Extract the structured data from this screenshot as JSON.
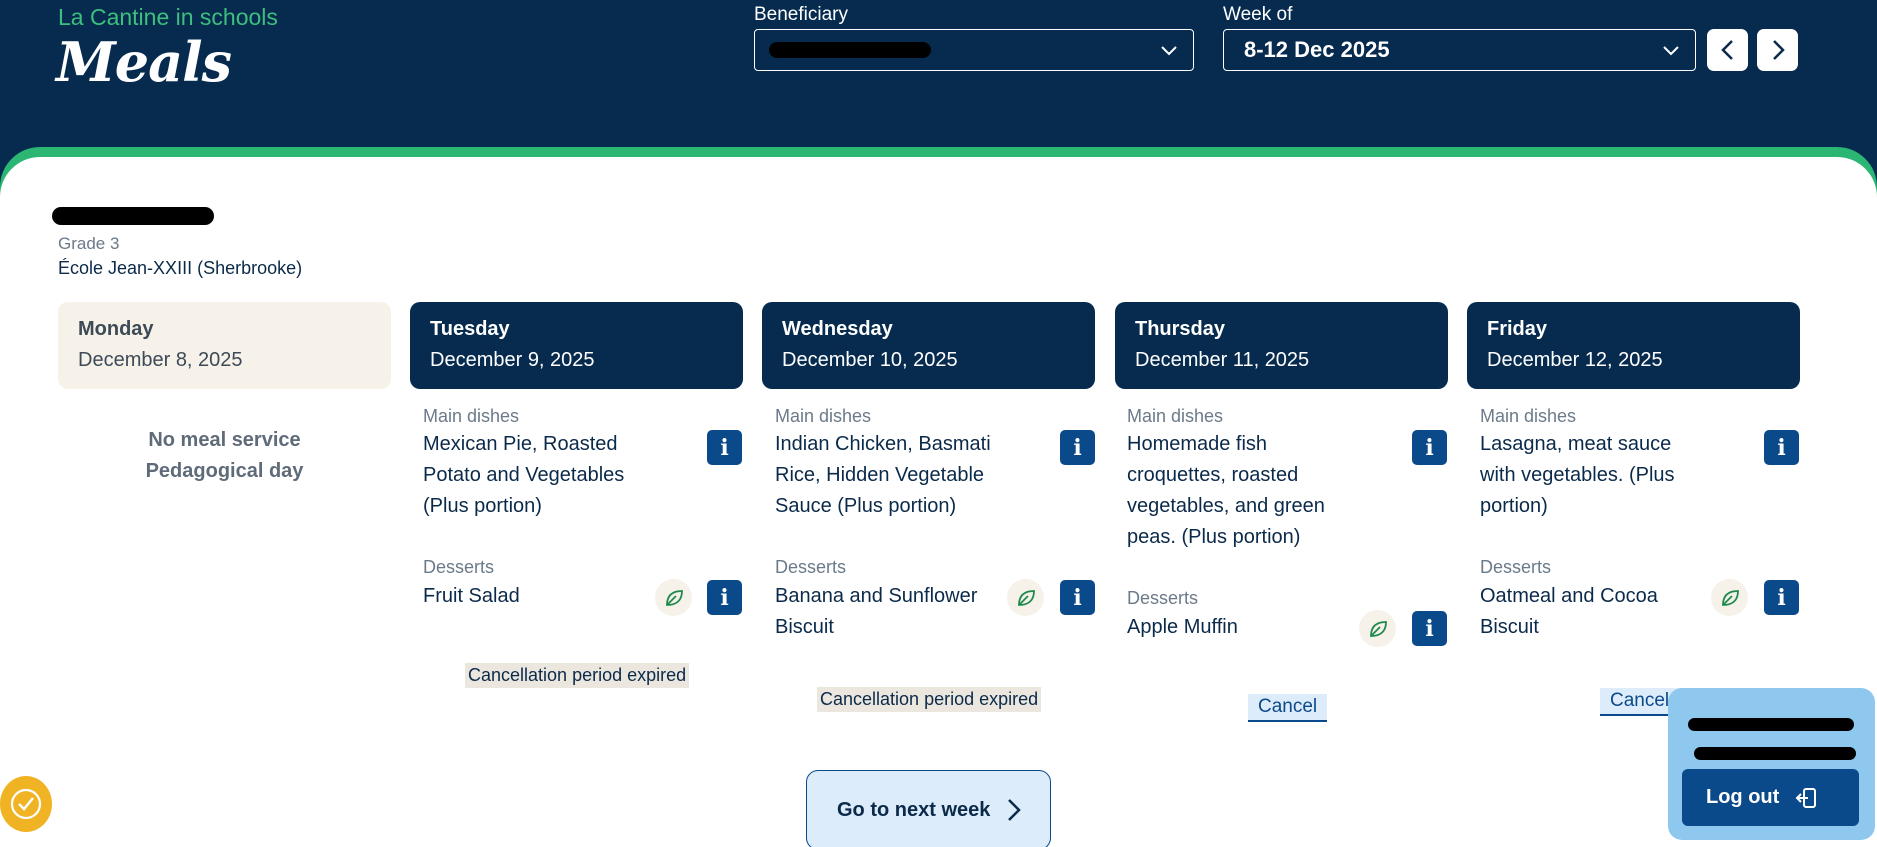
{
  "header": {
    "brand": "La Cantine in schools",
    "title": "Meals",
    "beneficiary_label": "Beneficiary",
    "beneficiary_value": "",
    "week_label": "Week of",
    "week_value": "8-12 Dec 2025"
  },
  "student": {
    "grade": "Grade 3",
    "school": "École Jean-XXIII (Sherbrooke)"
  },
  "days": [
    {
      "name": "Monday",
      "date": "December 8, 2025",
      "no_service": "No meal service",
      "reason": "Pedagogical day"
    },
    {
      "name": "Tuesday",
      "date": "December 9, 2025",
      "main_label": "Main dishes",
      "main": "Mexican Pie, Roasted Potato and Vegetables (Plus portion)",
      "dessert_label": "Desserts",
      "dessert": "Fruit Salad",
      "status": "Cancellation period expired"
    },
    {
      "name": "Wednesday",
      "date": "December 10, 2025",
      "main_label": "Main dishes",
      "main": "Indian Chicken, Basmati Rice, Hidden Vegetable Sauce (Plus portion)",
      "dessert_label": "Desserts",
      "dessert": "Banana and Sunflower Biscuit",
      "status": "Cancellation period expired"
    },
    {
      "name": "Thursday",
      "date": "December 11, 2025",
      "main_label": "Main dishes",
      "main": "Homemade fish croquettes, roasted vegetables, and green peas. (Plus portion)",
      "dessert_label": "Desserts",
      "dessert": "Apple Muffin",
      "action": "Cancel"
    },
    {
      "name": "Friday",
      "date": "December 12, 2025",
      "main_label": "Main dishes",
      "main": "Lasagna, meat sauce with vegetables. (Plus portion)",
      "dessert_label": "Desserts",
      "dessert": "Oatmeal and Cocoa Biscuit",
      "action": "Cancel"
    }
  ],
  "next_week_label": "Go to next week",
  "login": {
    "logout_label": "Log out"
  },
  "colors": {
    "navy": "#062b4f",
    "green": "#2bb673",
    "button_blue": "#0b4a8a",
    "light_blue": "#dcecfa"
  }
}
